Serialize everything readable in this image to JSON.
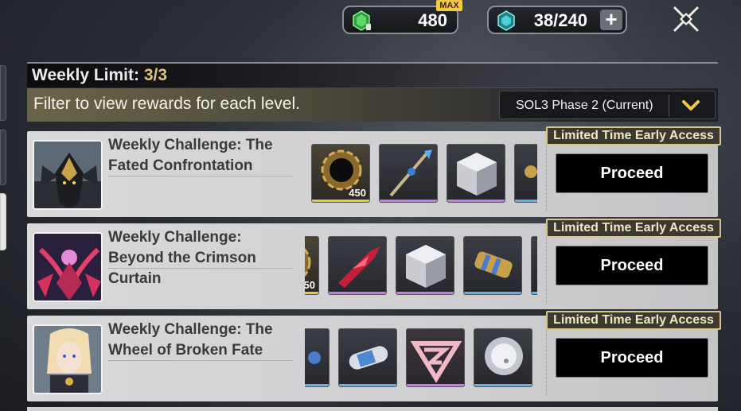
{
  "resources": {
    "first": {
      "value": "480",
      "badge": "MAX",
      "icon": "green-crystal-icon"
    },
    "second": {
      "value": "38/240",
      "plus": "+",
      "icon": "blue-crystal-icon"
    }
  },
  "weekly": {
    "label": "Weekly Limit: ",
    "count": "3/3"
  },
  "filter": {
    "text": "Filter to view rewards for each level.",
    "dropdown_value": "SOL3 Phase 2 (Current)"
  },
  "challenges": [
    {
      "title": "Weekly Challenge: The Fated Confrontation",
      "badge": "Limited Time Early Access",
      "button": "Proceed",
      "first_reward_qty": "450"
    },
    {
      "title": "Weekly Challenge: Beyond the Crimson Curtain",
      "badge": "Limited Time Early Access",
      "button": "Proceed",
      "partial_qty": "50"
    },
    {
      "title": "Weekly Challenge: The Wheel of Broken Fate",
      "badge": "Limited Time Early Access",
      "button": "Proceed"
    }
  ],
  "colors": {
    "gold_accent": "#e2c27a",
    "purple_rarity": "#c77ce8",
    "blue_rarity": "#5fb4e8",
    "gold_rarity": "#e8c84a",
    "badge_border": "#d9c48c"
  }
}
